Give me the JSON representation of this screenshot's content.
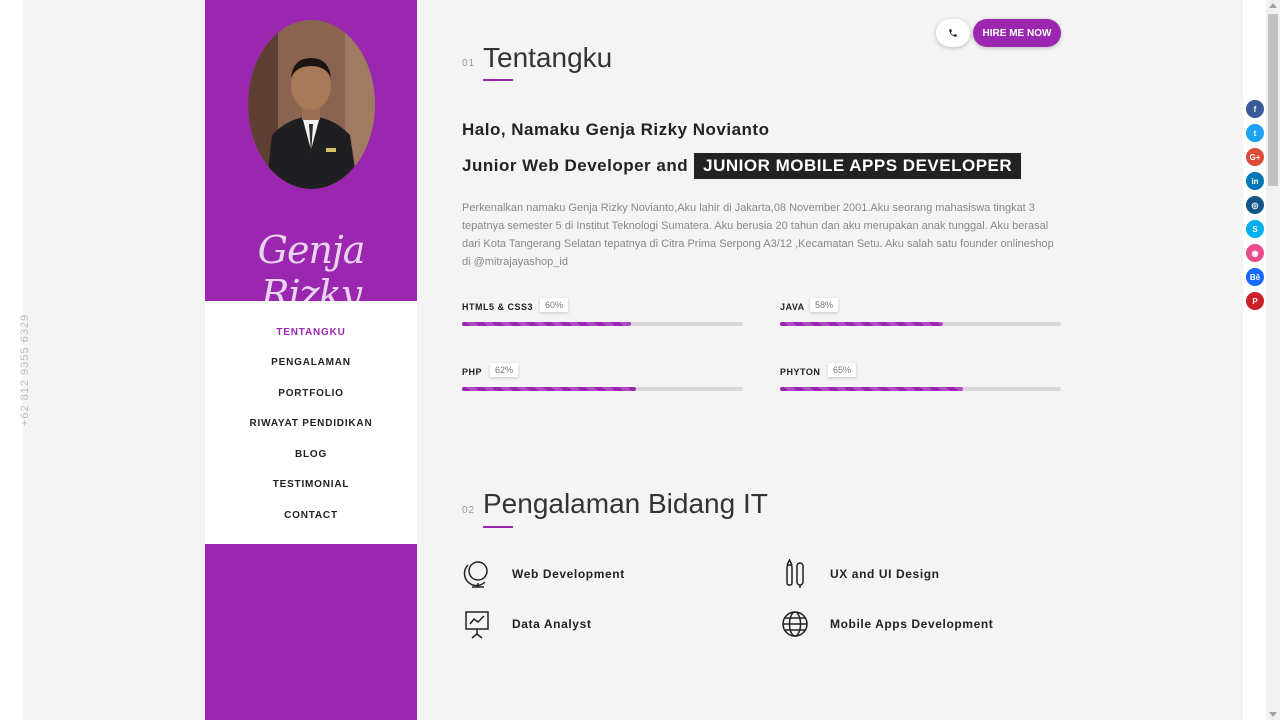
{
  "phone_vertical": "+62 812 9355 6329",
  "profile": {
    "signature": "Genja Rizky"
  },
  "nav": {
    "items": [
      {
        "label": "TENTANGKU",
        "active": true
      },
      {
        "label": "PENGALAMAN",
        "active": false
      },
      {
        "label": "PORTFOLIO",
        "active": false
      },
      {
        "label": "RIWAYAT PENDIDIKAN",
        "active": false
      },
      {
        "label": "BLOG",
        "active": false
      },
      {
        "label": "TESTIMONIAL",
        "active": false
      },
      {
        "label": "CONTACT",
        "active": false
      }
    ]
  },
  "header": {
    "phone_icon": "phone-icon",
    "hire_label": "HIRE ME NOW"
  },
  "about": {
    "num": "01",
    "title": "Tentangku",
    "hello": "Halo, Namaku Genja Rizky Novianto",
    "role_prefix": "Junior Web Developer and",
    "role_highlight": "JUNIOR MOBILE APPS DEVELOPER",
    "paragraph": "Perkenalkan namaku Genja Rizky Novianto,Aku lahir di Jakarta,08 November 2001.Aku seorang mahasiswa tingkat 3 tepatnya semester 5 di Institut Teknologi Sumatera. Aku berusia 20 tahun dan aku merupakan anak tunggal. Aku berasal dari Kota Tangerang Selatan tepatnya di Citra Prima Serpong A3/12 ,Kecamatan Setu. Aku salah satu founder onlineshop di @mitrajayashop_id"
  },
  "skills": [
    {
      "name": "HTML5 & CSS3",
      "percent_label": "60%",
      "value": 0.6
    },
    {
      "name": "JAVA",
      "percent_label": "58%",
      "value": 0.58
    },
    {
      "name": "PHP",
      "percent_label": "62%",
      "value": 0.62
    },
    {
      "name": "PHYTON",
      "percent_label": "65%",
      "value": 0.65
    }
  ],
  "experience": {
    "num": "02",
    "title": "Pengalaman Bidang IT",
    "services": [
      {
        "label": "Web Development",
        "icon": "globe-stand-icon"
      },
      {
        "label": "UX and UI Design",
        "icon": "pen-tools-icon"
      },
      {
        "label": "Data Analyst",
        "icon": "presentation-chart-icon"
      },
      {
        "label": "Mobile Apps Development",
        "icon": "world-icon"
      }
    ]
  },
  "social": [
    {
      "name": "facebook-icon",
      "glyph": "f",
      "color": "#3b5998"
    },
    {
      "name": "twitter-icon",
      "glyph": "t",
      "color": "#1da1f2"
    },
    {
      "name": "google-plus-icon",
      "glyph": "G+",
      "color": "#dd4b39"
    },
    {
      "name": "linkedin-icon",
      "glyph": "in",
      "color": "#0077b5"
    },
    {
      "name": "instagram-icon",
      "glyph": "◎",
      "color": "#125688"
    },
    {
      "name": "skype-icon",
      "glyph": "S",
      "color": "#00aff0"
    },
    {
      "name": "dribbble-icon",
      "glyph": "◉",
      "color": "#ea4c89"
    },
    {
      "name": "behance-icon",
      "glyph": "Bē",
      "color": "#1769ff"
    },
    {
      "name": "pinterest-icon",
      "glyph": "P",
      "color": "#cb2027"
    }
  ],
  "colors": {
    "accent": "#9b27b0",
    "background": "#f4f4f4"
  }
}
